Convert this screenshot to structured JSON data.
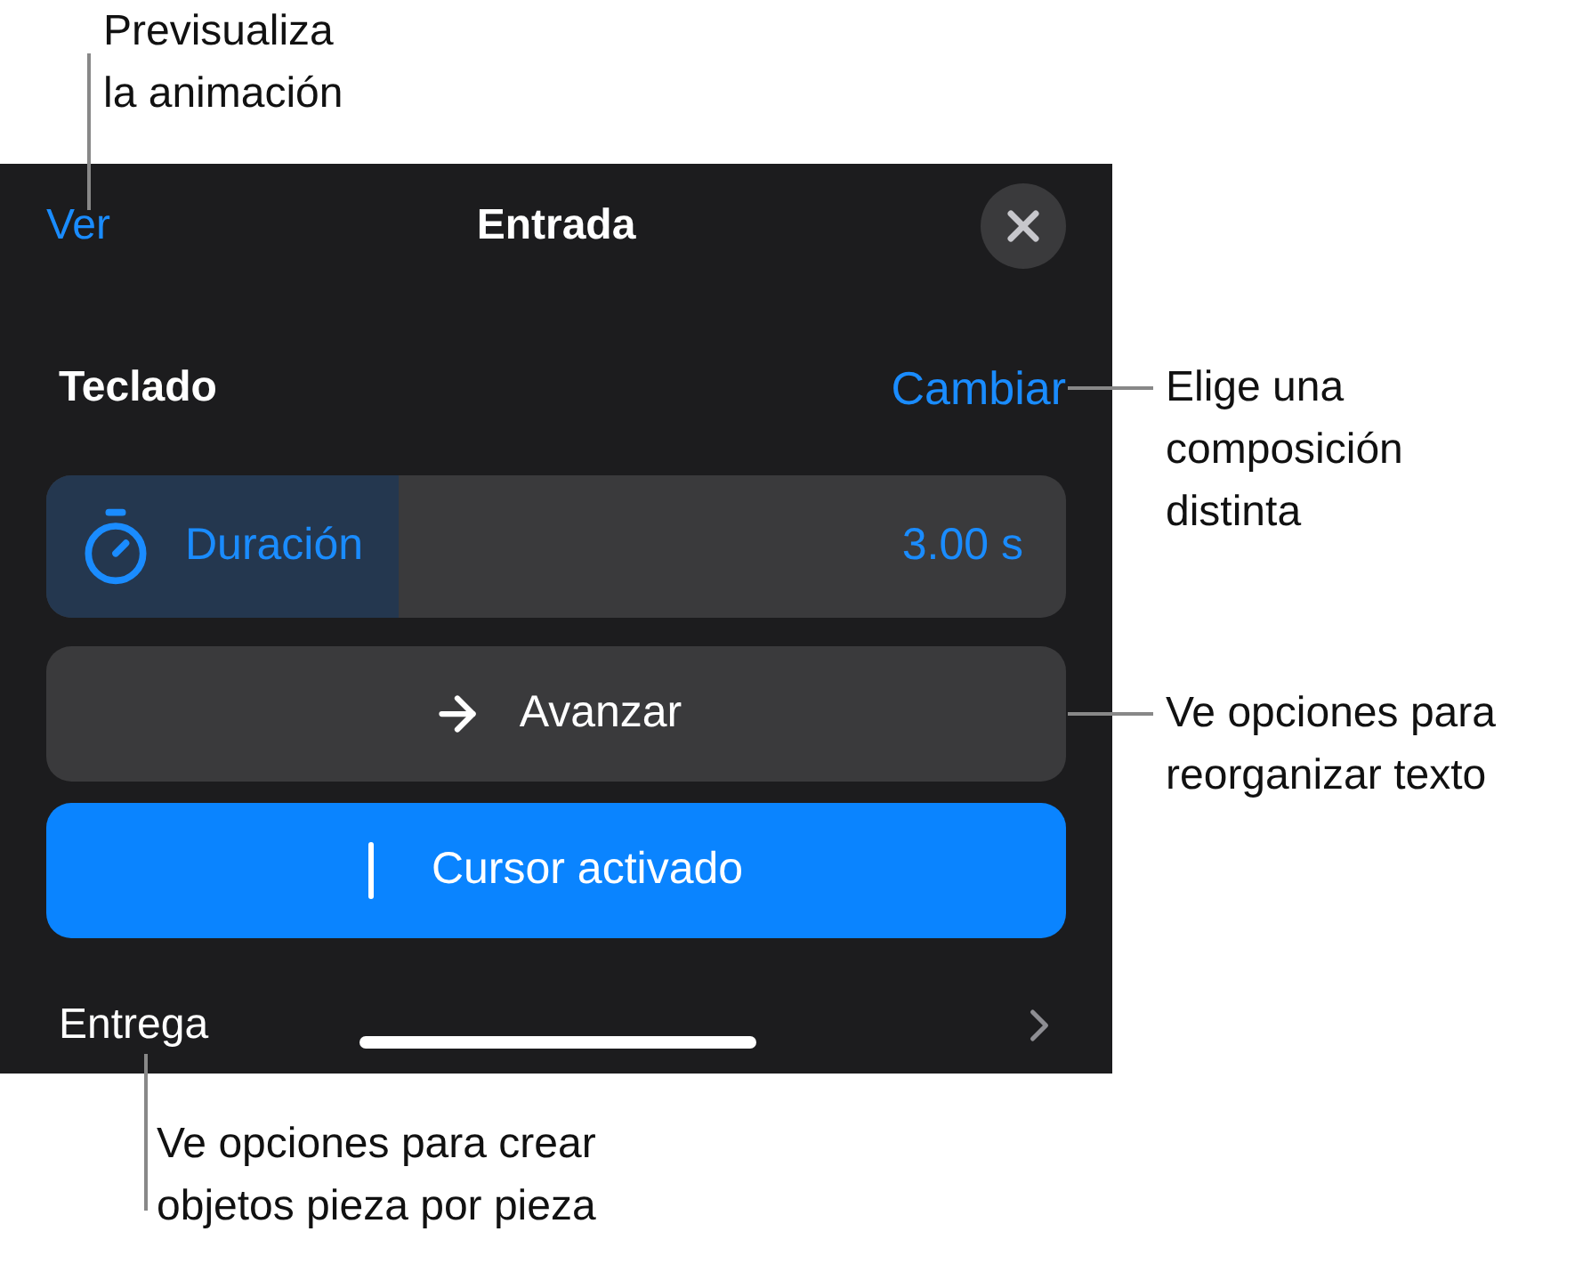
{
  "panel": {
    "preview_link": "Ver",
    "title": "Entrada",
    "layout_label": "Teclado",
    "change_link": "Cambiar",
    "duration": {
      "label": "Duración",
      "level": 0.345,
      "reading": "3.00 s"
    },
    "direction_button": {
      "label": "Avanzar"
    },
    "cursor_toggle": {
      "label": "Cursor activado",
      "on": true
    },
    "delivery_row": {
      "label": "Entrega"
    }
  },
  "callouts": [
    {
      "lines": [
        "Previsualiza",
        "la animación"
      ]
    },
    {
      "lines": [
        "Elige una",
        "composición",
        "distinta"
      ]
    },
    {
      "lines": [
        "Ve opciones para",
        "reorganizar texto"
      ]
    },
    {
      "lines": [
        "Ve opciones para crear",
        "objetos pieza por pieza"
      ]
    }
  ]
}
